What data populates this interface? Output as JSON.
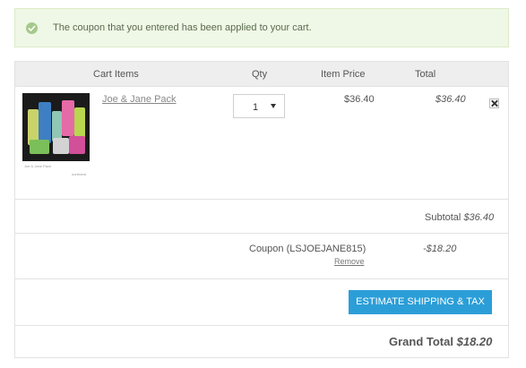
{
  "alert": {
    "message": "The coupon that you entered has been applied to your cart.",
    "icon": "check-circle-icon",
    "color": "#eff7e6"
  },
  "table": {
    "headers": {
      "items": "Cart Items",
      "qty": "Qty",
      "item_price": "Item Price",
      "total": "Total"
    }
  },
  "item": {
    "name": "Joe & Jane Pack",
    "quantity": "1",
    "price": "$36.40",
    "total": "$36.40",
    "thumb_caption_left": "Joe & Jane Pack",
    "thumb_caption_right": "ourbrand"
  },
  "subtotal": {
    "label": "Subtotal",
    "amount": "$36.40"
  },
  "coupon": {
    "label": "Coupon (LSJOEJANE815)",
    "remove": "Remove",
    "amount": "-$18.20"
  },
  "shipping": {
    "button": "ESTIMATE SHIPPING & TAX",
    "color": "#2b9ed8"
  },
  "grand": {
    "label": "Grand Total",
    "amount": "$18.20"
  }
}
